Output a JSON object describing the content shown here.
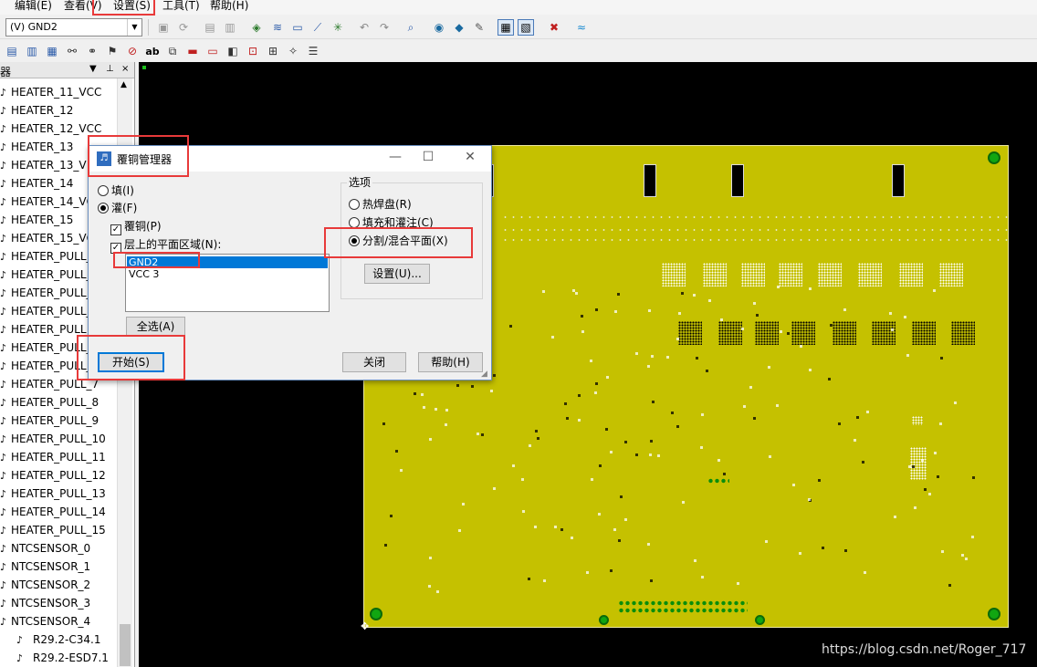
{
  "menu": {
    "items": [
      "编辑(E)",
      "查看(V)",
      "设置(S)",
      "工具(T)",
      "帮助(H)"
    ]
  },
  "toolbar": {
    "layer_select": "(V) GND2"
  },
  "tree": {
    "header_title": "器",
    "header_controls": [
      "▼",
      "⊥",
      "×"
    ],
    "nets": [
      "HEATER_11_VCC",
      "HEATER_12",
      "HEATER_12_VCC",
      "HEATER_13",
      "HEATER_13_V",
      "HEATER_14",
      "HEATER_14_VC",
      "HEATER_15",
      "HEATER_15_VC",
      "HEATER_PULL_",
      "HEATER_PULL_",
      "HEATER_PULL_",
      "HEATER_PULL_",
      "HEATER_PULL_",
      "HEATER_PULL_",
      "HEATER_PULL_",
      "HEATER_PULL_7",
      "HEATER_PULL_8",
      "HEATER_PULL_9",
      "HEATER_PULL_10",
      "HEATER_PULL_11",
      "HEATER_PULL_12",
      "HEATER_PULL_13",
      "HEATER_PULL_14",
      "HEATER_PULL_15",
      "NTCSENSOR_0",
      "NTCSENSOR_1",
      "NTCSENSOR_2",
      "NTCSENSOR_3",
      "NTCSENSOR_4"
    ],
    "sub_items": [
      "R29.2-C34.1",
      "R29.2-ESD7.1"
    ]
  },
  "dialog": {
    "title": "覆铜管理器",
    "mode_fill": "填(I)",
    "mode_flood": "灌(F)",
    "opt_pour": "覆铜(P)",
    "opt_plane_area": "层上的平面区域(N):",
    "layers": [
      {
        "name": "GND2",
        "checked": false,
        "selected": true
      },
      {
        "name": "VCC 3",
        "checked": false,
        "selected": false
      }
    ],
    "select_all": "全选(A)",
    "start": "开始(S)",
    "options_title": "选项",
    "opt_thermal": "热焊盘(R)",
    "opt_fill_flood": "填充和灌注(C)",
    "opt_split_plane": "分割/混合平面(X)",
    "settings_button": "设置(U)...",
    "close_button": "关闭",
    "help_button": "帮助(H)"
  },
  "watermark": "https://blog.csdn.net/Roger_717",
  "colors": {
    "board": "#c5c100",
    "canvas": "#000000",
    "via": "#11a611",
    "highlight": "#e83a3a",
    "selection": "#0078d7"
  }
}
